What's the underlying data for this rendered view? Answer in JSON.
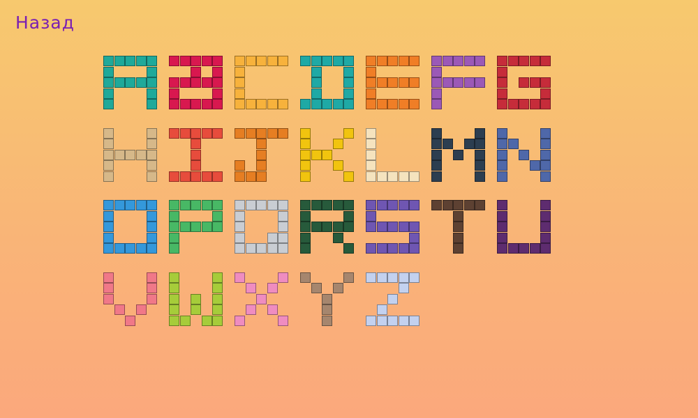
{
  "back_label": "Назад",
  "letters": [
    {
      "char": "A",
      "color": "#1fa99a",
      "pattern": [
        "11111",
        "10001",
        "11111",
        "10001",
        "10001"
      ]
    },
    {
      "char": "B",
      "color": "#d8184f",
      "pattern": [
        "11111",
        "00101",
        "11111",
        "10001",
        "11111"
      ]
    },
    {
      "char": "C",
      "color": "#f7b23c",
      "pattern": [
        "11111",
        "10000",
        "10000",
        "10000",
        "11111"
      ]
    },
    {
      "char": "D",
      "color": "#1fa9a5",
      "pattern": [
        "11111",
        "01001",
        "01001",
        "01001",
        "11111"
      ]
    },
    {
      "char": "E",
      "color": "#f07e26",
      "pattern": [
        "11111",
        "10000",
        "11111",
        "10000",
        "11111"
      ]
    },
    {
      "char": "F",
      "color": "#9b59b6",
      "pattern": [
        "11111",
        "10000",
        "11111",
        "10000",
        "10000"
      ]
    },
    {
      "char": "G",
      "color": "#c62c3a",
      "pattern": [
        "11111",
        "10000",
        "10111",
        "10001",
        "11111"
      ]
    },
    {
      "char": "H",
      "color": "#d6b889",
      "pattern": [
        "10001",
        "10001",
        "11111",
        "10001",
        "10001"
      ]
    },
    {
      "char": "I",
      "color": "#e74c3c",
      "pattern": [
        "11111",
        "00100",
        "00100",
        "00100",
        "11111"
      ]
    },
    {
      "char": "J",
      "color": "#e67e22",
      "pattern": [
        "11111",
        "00100",
        "00100",
        "10100",
        "11100"
      ]
    },
    {
      "char": "K",
      "color": "#f1c40f",
      "pattern": [
        "10001",
        "10010",
        "11100",
        "10010",
        "10001"
      ]
    },
    {
      "char": "L",
      "color": "#f5e3be",
      "pattern": [
        "10000",
        "10000",
        "10000",
        "10000",
        "11111"
      ]
    },
    {
      "char": "M",
      "color": "#2c3e50",
      "pattern": [
        "10001",
        "11011",
        "10101",
        "10001",
        "10001"
      ]
    },
    {
      "char": "N",
      "color": "#4f68a9",
      "pattern": [
        "10001",
        "11001",
        "10101",
        "10011",
        "10001"
      ]
    },
    {
      "char": "O",
      "color": "#3498db",
      "pattern": [
        "11111",
        "10001",
        "10001",
        "10001",
        "11111"
      ]
    },
    {
      "char": "P",
      "color": "#48b865",
      "pattern": [
        "11111",
        "10001",
        "11111",
        "10000",
        "10000"
      ]
    },
    {
      "char": "Q",
      "color": "#c9cdd3",
      "pattern": [
        "11111",
        "10001",
        "10001",
        "10011",
        "11111"
      ]
    },
    {
      "char": "R",
      "color": "#275a3b",
      "pattern": [
        "11111",
        "10001",
        "11111",
        "10010",
        "10001"
      ]
    },
    {
      "char": "S",
      "color": "#6f56b2",
      "pattern": [
        "11111",
        "10000",
        "11111",
        "00001",
        "11111"
      ]
    },
    {
      "char": "T",
      "color": "#5d4132",
      "pattern": [
        "11111",
        "00100",
        "00100",
        "00100",
        "00100"
      ]
    },
    {
      "char": "U",
      "color": "#5e2c6f",
      "pattern": [
        "10001",
        "10001",
        "10001",
        "10001",
        "11111"
      ]
    },
    {
      "char": "V",
      "color": "#f07888",
      "pattern": [
        "10001",
        "10001",
        "10001",
        "01010",
        "00100"
      ]
    },
    {
      "char": "W",
      "color": "#a6cc3a",
      "pattern": [
        "10001",
        "10001",
        "10101",
        "10101",
        "11011"
      ]
    },
    {
      "char": "X",
      "color": "#ef8cc0",
      "pattern": [
        "10001",
        "01010",
        "00100",
        "01010",
        "10001"
      ]
    },
    {
      "char": "Y",
      "color": "#a6866e",
      "pattern": [
        "10001",
        "01010",
        "00100",
        "00100",
        "00100"
      ]
    },
    {
      "char": "Z",
      "color": "#c3d1ef",
      "pattern": [
        "11111",
        "00010",
        "00100",
        "01000",
        "11111"
      ]
    }
  ]
}
